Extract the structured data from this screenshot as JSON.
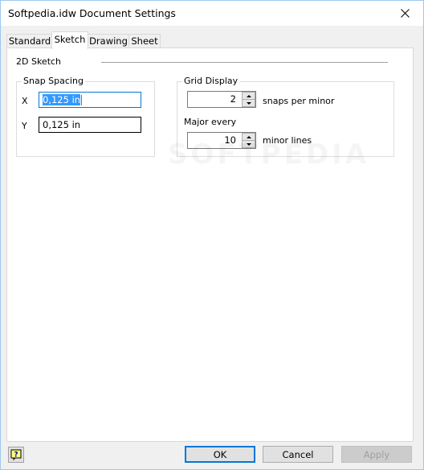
{
  "window": {
    "title": "Softpedia.idw Document Settings",
    "close_icon": "close-icon"
  },
  "tabs": [
    {
      "label": "Standard",
      "active": false
    },
    {
      "label": "Sketch",
      "active": true
    },
    {
      "label": "Drawing",
      "active": false
    },
    {
      "label": "Sheet",
      "active": false
    }
  ],
  "sketch": {
    "section_label": "2D Sketch",
    "snap_spacing": {
      "legend": "Snap Spacing",
      "x_label": "X",
      "x_value": "0,125 in",
      "y_label": "Y",
      "y_value": "0,125 in"
    },
    "grid_display": {
      "legend": "Grid Display",
      "snaps_value": "2",
      "snaps_suffix": "snaps per minor",
      "major_label": "Major every",
      "major_value": "10",
      "major_suffix": "minor lines"
    }
  },
  "watermark": "SOFTPEDIA",
  "footer": {
    "help_icon": "help-icon",
    "ok_label": "OK",
    "cancel_label": "Cancel",
    "apply_label": "Apply"
  },
  "colors": {
    "accent": "#0078d7",
    "selection": "#3399ff",
    "window_border": "#9cc8ef"
  }
}
